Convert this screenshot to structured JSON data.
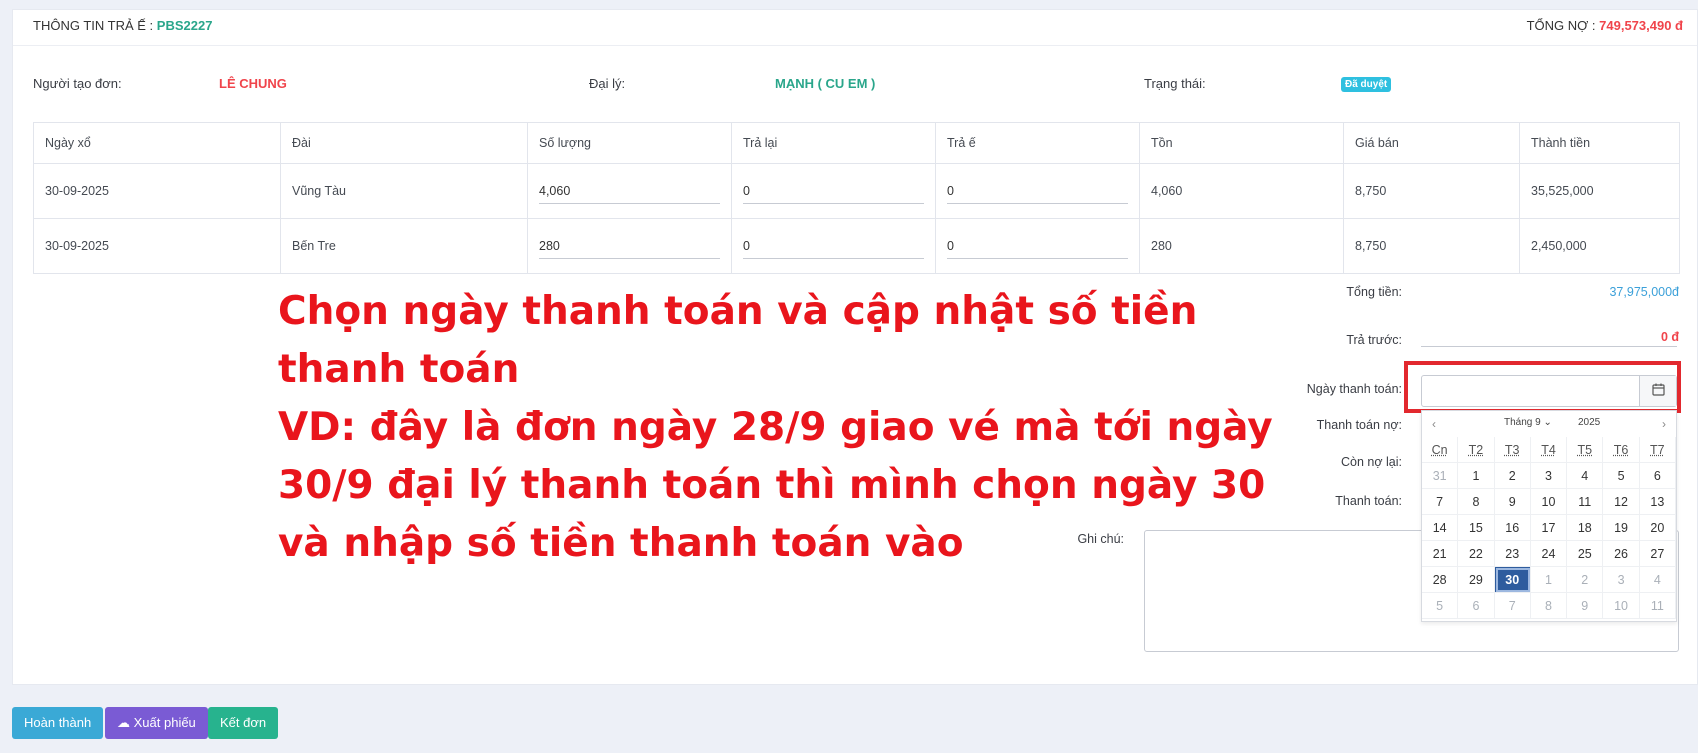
{
  "header": {
    "title_label": "THÔNG TIN TRẢ Ế :",
    "order_code": "PBS2227",
    "debt_label": "TỔNG NỢ :",
    "debt_value": "749,573,490 đ"
  },
  "info": {
    "creator_label": "Người tạo đơn:",
    "creator_value": "LÊ CHUNG",
    "agent_label": "Đại lý:",
    "agent_value": "MẠNH ( CU EM )",
    "status_label": "Trạng thái:",
    "status_value": "Đã duyệt"
  },
  "table": {
    "headers": [
      "Ngày xổ",
      "Đài",
      "Số lượng",
      "Trả lại",
      "Trả ế",
      "Tồn",
      "Giá bán",
      "Thành tiền"
    ],
    "rows": [
      {
        "date": "30-09-2025",
        "station": "Vũng Tàu",
        "qty": "4,060",
        "returned": "0",
        "unsold": "0",
        "stock": "4,060",
        "price": "8,750",
        "total": "35,525,000"
      },
      {
        "date": "30-09-2025",
        "station": "Bến Tre",
        "qty": "280",
        "returned": "0",
        "unsold": "0",
        "stock": "280",
        "price": "8,750",
        "total": "2,450,000"
      }
    ]
  },
  "summary": {
    "total_label": "Tổng tiền:",
    "total_value": "37,975,000đ",
    "prepaid_label": "Trả trước:",
    "prepaid_value": "0 đ",
    "paydate_label": "Ngày thanh toán:",
    "paydebt_label": "Thanh toán nợ:",
    "remaining_label": "Còn nợ lại:",
    "payment_label": "Thanh toán:",
    "note_label": "Ghi chú:"
  },
  "calendar": {
    "prev": "‹",
    "next": "›",
    "month": "Tháng 9",
    "year": "2025",
    "weekdays": [
      "Cn",
      "T2",
      "T3",
      "T4",
      "T5",
      "T6",
      "T7"
    ],
    "days": [
      "31",
      "1",
      "2",
      "3",
      "4",
      "5",
      "6",
      "7",
      "8",
      "9",
      "10",
      "11",
      "12",
      "13",
      "14",
      "15",
      "16",
      "17",
      "18",
      "19",
      "20",
      "21",
      "22",
      "23",
      "24",
      "25",
      "26",
      "27",
      "28",
      "29",
      "30",
      "1",
      "2",
      "3",
      "4",
      "5",
      "6",
      "7",
      "8",
      "9",
      "10",
      "11"
    ],
    "selected": "30"
  },
  "annotation": {
    "line1": "Chọn ngày thanh toán và cập nhật số tiền thanh toán",
    "line2": "VD: đây là đơn ngày 28/9 giao vé mà tới ngày 30/9 đại lý thanh toán thì mình chọn ngày 30 và nhập số tiền thanh toán vào"
  },
  "buttons": {
    "complete": "Hoàn thành",
    "export": "Xuất phiếu",
    "close": "Kết đơn"
  },
  "colors": {
    "accent_green": "#2aa68b",
    "accent_red": "#f0444b",
    "btn_complete": "#3aa9d6",
    "btn_export": "#7a5bd4",
    "btn_close": "#27b38e"
  }
}
